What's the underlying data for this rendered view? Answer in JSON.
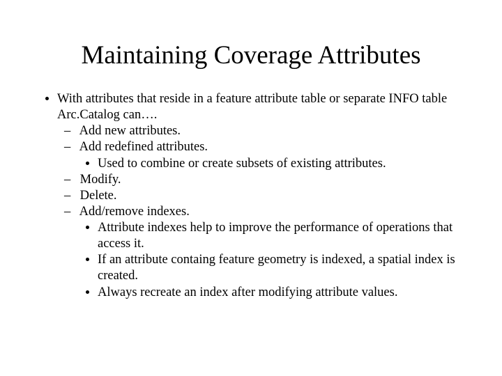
{
  "title": "Maintaining Coverage Attributes",
  "bullet": {
    "intro": "With attributes that reside in a feature attribute table or separate INFO table Arc.Catalog can….",
    "items": [
      {
        "text": "Add new attributes.",
        "sub": []
      },
      {
        "text": "Add redefined attributes.",
        "sub": [
          "Used to combine or create subsets of existing attributes."
        ]
      },
      {
        "text": "Modify.",
        "sub": []
      },
      {
        "text": "Delete.",
        "sub": []
      },
      {
        "text": "Add/remove indexes.",
        "sub": [
          "Attribute indexes help to improve the performance of operations that access it.",
          "If an attribute containg feature geometry is indexed, a spatial index is created.",
          "Always recreate an index after modifying attribute values."
        ]
      }
    ]
  }
}
